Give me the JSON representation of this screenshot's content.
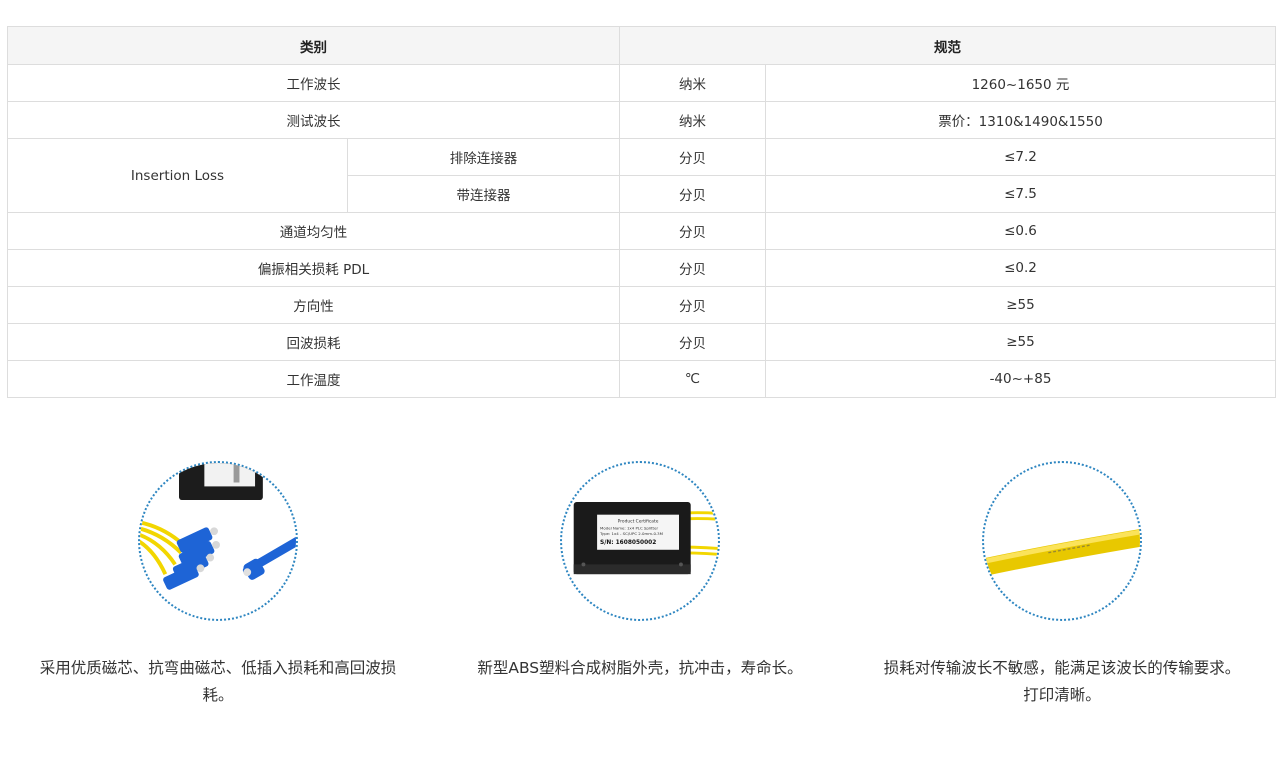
{
  "table": {
    "headers": {
      "category": "类别",
      "spec": "规范"
    },
    "rows": [
      {
        "name": "工作波长",
        "unit": "纳米",
        "value": "1260~1650 元"
      },
      {
        "name": "测试波长",
        "unit": "纳米",
        "value": "票价：1310&1490&1550"
      },
      {
        "group": "Insertion Loss",
        "name": "排除连接器",
        "unit": "分贝",
        "value": "≤7.2"
      },
      {
        "name": "带连接器",
        "unit": "分贝",
        "value": "≤7.5"
      },
      {
        "name": "通道均匀性",
        "unit": "分贝",
        "value": "≤0.6"
      },
      {
        "name": "偏振相关损耗 PDL",
        "unit": "分贝",
        "value": "≤0.2"
      },
      {
        "name": "方向性",
        "unit": "分贝",
        "value": "≥55"
      },
      {
        "name": "回波损耗",
        "unit": "分贝",
        "value": "≥55"
      },
      {
        "name": "工作温度",
        "unit": "℃",
        "value": "-40~+85"
      }
    ]
  },
  "features": [
    {
      "image": "fiber-splitter-connectors-photo",
      "caption": "采用优质磁芯、抗弯曲磁芯、低插入损耗和高回波损耗。"
    },
    {
      "image": "abs-box-splitter-photo",
      "label_title": "Product Certificate",
      "label_model": "Model Name: 1x4 PLC Splitter",
      "label_type": "Type: 1x4 - SC/UPC 2.0mm-0.3M",
      "label_sn": "S/N: 1608050002",
      "caption": "新型ABS塑料合成树脂外壳，抗冲击，寿命长。"
    },
    {
      "image": "yellow-fiber-cable-photo",
      "caption": "损耗对传输波长不敏感，能满足该波长的传输要求。打印清晰。"
    }
  ]
}
